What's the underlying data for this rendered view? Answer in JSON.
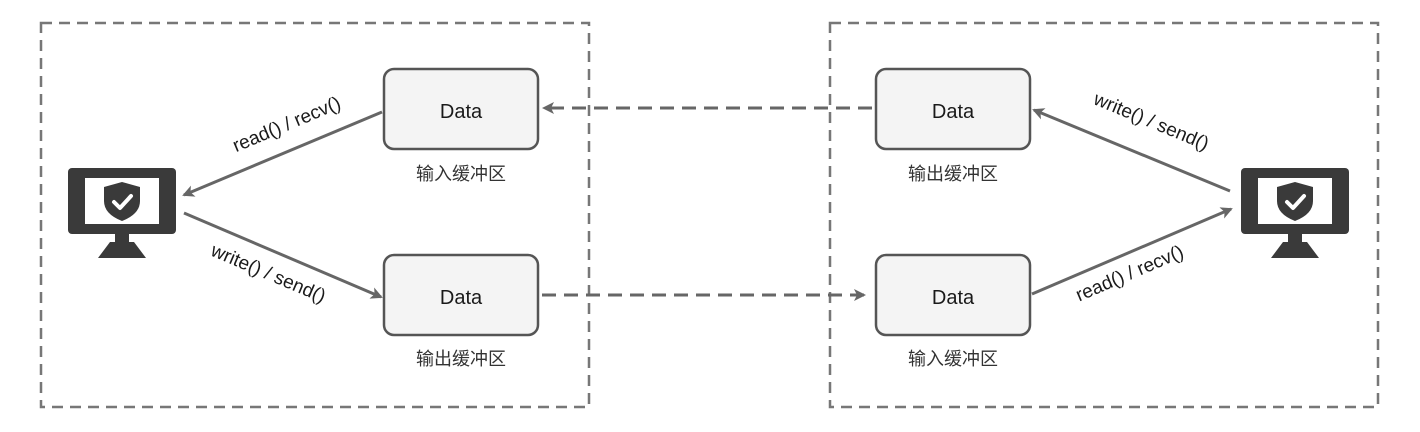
{
  "colors": {
    "line": "#666666",
    "border_dash": "#777777",
    "box_fill": "#f4f4f4",
    "box_stroke": "#555555",
    "monitor": "#3a3a3a"
  },
  "left_host": {
    "input_buffer": {
      "box_text": "Data",
      "caption": "输入缓冲区"
    },
    "output_buffer": {
      "box_text": "Data",
      "caption": "输出缓冲区"
    },
    "read_label": "read() / recv()",
    "write_label": "write() / send()",
    "monitor_icon": "shield-check-monitor"
  },
  "right_host": {
    "output_buffer": {
      "box_text": "Data",
      "caption": "输出缓冲区"
    },
    "input_buffer": {
      "box_text": "Data",
      "caption": "输入缓冲区"
    },
    "write_label": "write() / send()",
    "read_label": "read() / recv()",
    "monitor_icon": "shield-check-monitor"
  }
}
